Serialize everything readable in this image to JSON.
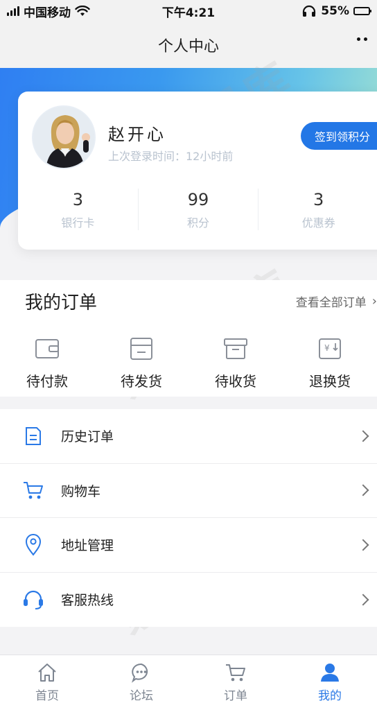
{
  "status_bar": {
    "carrier": "中国移动",
    "time": "下午4:21",
    "battery": "55%",
    "battery_level": 0.55
  },
  "nav": {
    "title": "个人中心"
  },
  "profile": {
    "name": "赵开心",
    "last_login": "上次登录时间：12小时前",
    "checkin_label": "签到领积分",
    "stats": [
      {
        "value": "3",
        "label": "银行卡"
      },
      {
        "value": "99",
        "label": "积分"
      },
      {
        "value": "3",
        "label": "优惠券"
      }
    ]
  },
  "orders": {
    "title": "我的订单",
    "view_all": "查看全部订单",
    "items": [
      {
        "label": "待付款",
        "icon": "wallet-icon"
      },
      {
        "label": "待发货",
        "icon": "package-icon"
      },
      {
        "label": "待收货",
        "icon": "box-icon"
      },
      {
        "label": "退换货",
        "icon": "refund-icon"
      }
    ]
  },
  "menu": {
    "items": [
      {
        "label": "历史订单",
        "icon": "document-icon"
      },
      {
        "label": "购物车",
        "icon": "cart-icon"
      },
      {
        "label": "地址管理",
        "icon": "location-icon"
      },
      {
        "label": "客服热线",
        "icon": "headset-icon"
      }
    ]
  },
  "tabs": [
    {
      "label": "首页",
      "icon": "home-icon",
      "active": false
    },
    {
      "label": "论坛",
      "icon": "chat-icon",
      "active": false
    },
    {
      "label": "订单",
      "icon": "cart-icon",
      "active": false
    },
    {
      "label": "我的",
      "icon": "user-icon",
      "active": true
    }
  ],
  "colors": {
    "accent": "#2a79e6",
    "gradient_start": "#2f7ff2",
    "gradient_end": "#9ee0d2",
    "muted_text": "#b9c3cf"
  },
  "watermark": "素材图库"
}
